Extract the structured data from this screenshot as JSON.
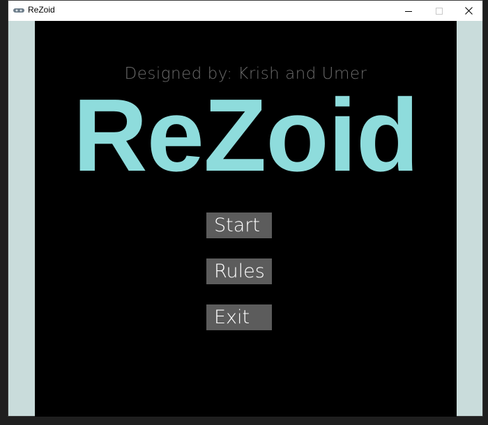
{
  "window": {
    "title": "ReZoid",
    "controls": [
      "minimize-icon",
      "maximize-icon",
      "close-icon"
    ]
  },
  "game": {
    "credits": "Designed by: Krish and Umer",
    "title": "ReZoid",
    "menu": {
      "start_label": "Start",
      "rules_label": "Rules",
      "exit_label": "Exit"
    }
  },
  "colors": {
    "title_color": "#8edcdc",
    "credits_color": "#6b6b6b",
    "button_bg": "#5c5c5c",
    "canvas_bg": "#000000",
    "window_bg": "#c9dcdb"
  }
}
